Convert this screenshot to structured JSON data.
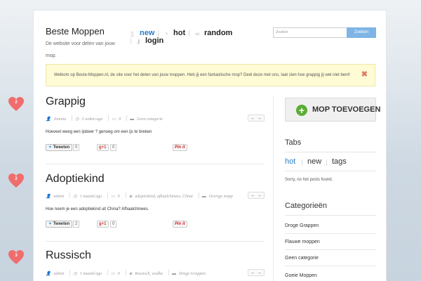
{
  "header": {
    "site_title": "Beste Moppen",
    "site_description": "De website voor delen van jouw mop.",
    "nav": [
      {
        "label": "new",
        "icon": "new-icon",
        "active": true
      },
      {
        "label": "hot",
        "icon": "hot-icon",
        "active": false
      },
      {
        "label": "random",
        "icon": "random-icon",
        "active": false
      },
      {
        "label": "login",
        "icon": "login-icon",
        "active": false
      }
    ],
    "search": {
      "placeholder": "Zoeken",
      "button_label": "Zoeken"
    }
  },
  "notice": {
    "text": "Welkom op Beste-Moppen.nl, de site voor het delen van jouw moppen. Heb jij een fantastische mop? Deel deze met ons, laat zien hoe grappig jij wel niet bent!",
    "close_glyph": "✖"
  },
  "posts": [
    {
      "votes": "2",
      "title": "Grappig",
      "author": "Joanna",
      "time": "3 weken ago",
      "comments": "0",
      "tags": "",
      "category": "Geen categorie",
      "excerpt": "Hoeveel weeg een ijsbeer ? genoeg om een ijs te breken",
      "tweet_label": "Tweeten",
      "tweet_count": "0",
      "gplus_label": "+1",
      "gplus_count": "0",
      "pin_label": "Pin it"
    },
    {
      "votes": "2",
      "title": "Adoptiekind",
      "author": "admin",
      "time": "1 maand ago",
      "comments": "0",
      "tags": "adoptiekind, afhaalchinees, China",
      "category": "Overige mopp",
      "excerpt": "Hoe noem je een adoptiekind uit China? Afhaalchinees.",
      "tweet_label": "Tweeten",
      "tweet_count": "2",
      "gplus_label": "+1",
      "gplus_count": "0",
      "pin_label": "Pin it"
    },
    {
      "votes": "3",
      "title": "Russisch",
      "author": "admin",
      "time": "1 maand ago",
      "comments": "0",
      "tags": "Russisch, wodka",
      "category": "Droge Grappen"
    }
  ],
  "pager": {
    "prev": "←",
    "next": "→"
  },
  "sidebar": {
    "add_button_label": "MOP TOEVOEGEN",
    "tabs_title": "Tabs",
    "tabs": [
      "hot",
      "new",
      "tags"
    ],
    "no_posts": "Sorry, no hot posts found.",
    "categories_title": "Categorieën",
    "categories": [
      "Droge Grappen",
      "Flauwe moppen",
      "Geen categorie",
      "Goeie Moppen"
    ]
  },
  "colors": {
    "accent": "#2a7cc7",
    "heart": "#f06d6d",
    "notice_bg": "#fefbd5",
    "add_icon": "#5aac35"
  }
}
